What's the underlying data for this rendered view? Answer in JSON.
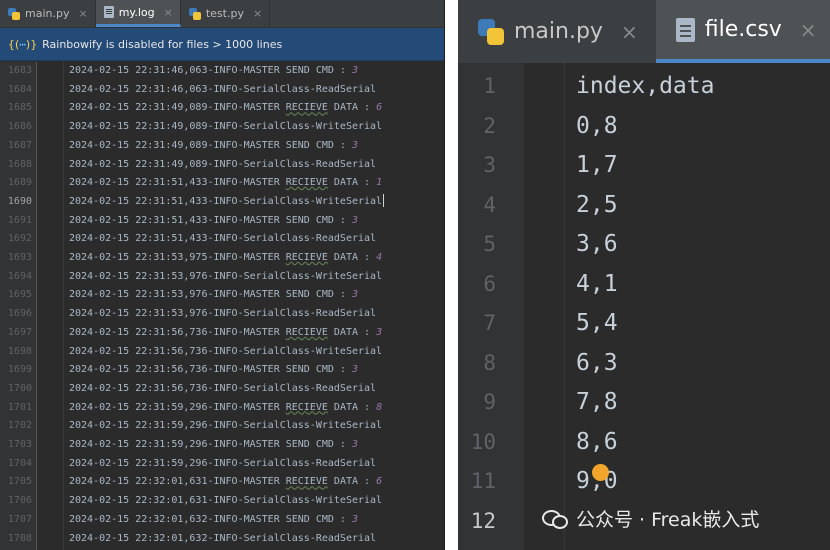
{
  "left_panel": {
    "tabs": [
      {
        "label": "main.py",
        "icon": "python-file-icon",
        "active": false
      },
      {
        "label": "my.log",
        "icon": "log-file-icon",
        "active": true
      },
      {
        "label": "test.py",
        "icon": "python-file-icon",
        "active": false
      }
    ],
    "close_glyph": "×",
    "banner": {
      "icon": "rainbowify-icon",
      "text": "Rainbowify is disabled for files > 1000 lines"
    },
    "current_line": "1690",
    "lines": [
      {
        "n": "1683",
        "pre": "2024-02-15 22:31:46,063-INFO-MASTER SEND CMD : ",
        "kw": "",
        "post": "",
        "num": "3"
      },
      {
        "n": "1684",
        "pre": "2024-02-15 22:31:46,063-INFO-SerialClass-ReadSerial",
        "kw": "",
        "post": "",
        "num": ""
      },
      {
        "n": "1685",
        "pre": "2024-02-15 22:31:49,089-INFO-MASTER ",
        "kw": "RECIEVE",
        "post": " DATA : ",
        "num": "6"
      },
      {
        "n": "1686",
        "pre": "2024-02-15 22:31:49,089-INFO-SerialClass-WriteSerial",
        "kw": "",
        "post": "",
        "num": ""
      },
      {
        "n": "1687",
        "pre": "2024-02-15 22:31:49,089-INFO-MASTER SEND CMD : ",
        "kw": "",
        "post": "",
        "num": "3"
      },
      {
        "n": "1688",
        "pre": "2024-02-15 22:31:49,089-INFO-SerialClass-ReadSerial",
        "kw": "",
        "post": "",
        "num": ""
      },
      {
        "n": "1689",
        "pre": "2024-02-15 22:31:51,433-INFO-MASTER ",
        "kw": "RECIEVE",
        "post": " DATA : ",
        "num": "1"
      },
      {
        "n": "1690",
        "pre": "2024-02-15 22:31:51,433-INFO-SerialClass-WriteSerial",
        "kw": "",
        "post": "",
        "num": ""
      },
      {
        "n": "1691",
        "pre": "2024-02-15 22:31:51,433-INFO-MASTER SEND CMD : ",
        "kw": "",
        "post": "",
        "num": "3"
      },
      {
        "n": "1692",
        "pre": "2024-02-15 22:31:51,433-INFO-SerialClass-ReadSerial",
        "kw": "",
        "post": "",
        "num": ""
      },
      {
        "n": "1693",
        "pre": "2024-02-15 22:31:53,975-INFO-MASTER ",
        "kw": "RECIEVE",
        "post": " DATA : ",
        "num": "4"
      },
      {
        "n": "1694",
        "pre": "2024-02-15 22:31:53,976-INFO-SerialClass-WriteSerial",
        "kw": "",
        "post": "",
        "num": ""
      },
      {
        "n": "1695",
        "pre": "2024-02-15 22:31:53,976-INFO-MASTER SEND CMD : ",
        "kw": "",
        "post": "",
        "num": "3"
      },
      {
        "n": "1696",
        "pre": "2024-02-15 22:31:53,976-INFO-SerialClass-ReadSerial",
        "kw": "",
        "post": "",
        "num": ""
      },
      {
        "n": "1697",
        "pre": "2024-02-15 22:31:56,736-INFO-MASTER ",
        "kw": "RECIEVE",
        "post": " DATA : ",
        "num": "3"
      },
      {
        "n": "1698",
        "pre": "2024-02-15 22:31:56,736-INFO-SerialClass-WriteSerial",
        "kw": "",
        "post": "",
        "num": ""
      },
      {
        "n": "1699",
        "pre": "2024-02-15 22:31:56,736-INFO-MASTER SEND CMD : ",
        "kw": "",
        "post": "",
        "num": "3"
      },
      {
        "n": "1700",
        "pre": "2024-02-15 22:31:56,736-INFO-SerialClass-ReadSerial",
        "kw": "",
        "post": "",
        "num": ""
      },
      {
        "n": "1701",
        "pre": "2024-02-15 22:31:59,296-INFO-MASTER ",
        "kw": "RECIEVE",
        "post": " DATA : ",
        "num": "8"
      },
      {
        "n": "1702",
        "pre": "2024-02-15 22:31:59,296-INFO-SerialClass-WriteSerial",
        "kw": "",
        "post": "",
        "num": ""
      },
      {
        "n": "1703",
        "pre": "2024-02-15 22:31:59,296-INFO-MASTER SEND CMD : ",
        "kw": "",
        "post": "",
        "num": "3"
      },
      {
        "n": "1704",
        "pre": "2024-02-15 22:31:59,296-INFO-SerialClass-ReadSerial",
        "kw": "",
        "post": "",
        "num": ""
      },
      {
        "n": "1705",
        "pre": "2024-02-15 22:32:01,631-INFO-MASTER ",
        "kw": "RECIEVE",
        "post": " DATA : ",
        "num": "6"
      },
      {
        "n": "1706",
        "pre": "2024-02-15 22:32:01,631-INFO-SerialClass-WriteSerial",
        "kw": "",
        "post": "",
        "num": ""
      },
      {
        "n": "1707",
        "pre": "2024-02-15 22:32:01,632-INFO-MASTER SEND CMD : ",
        "kw": "",
        "post": "",
        "num": "3"
      },
      {
        "n": "1708",
        "pre": "2024-02-15 22:32:01,632-INFO-SerialClass-ReadSerial",
        "kw": "",
        "post": "",
        "num": ""
      }
    ]
  },
  "right_panel": {
    "tabs": [
      {
        "label": "main.py",
        "icon": "python-file-icon",
        "active": false
      },
      {
        "label": "file.csv",
        "icon": "csv-file-icon",
        "active": true
      }
    ],
    "close_glyph": "×",
    "current_line": "12",
    "lines": [
      {
        "n": "1",
        "text": "index,data"
      },
      {
        "n": "2",
        "text": "0,8"
      },
      {
        "n": "3",
        "text": "1,7"
      },
      {
        "n": "4",
        "text": "2,5"
      },
      {
        "n": "5",
        "text": "3,6"
      },
      {
        "n": "6",
        "text": "4,1"
      },
      {
        "n": "7",
        "text": "5,4"
      },
      {
        "n": "8",
        "text": "6,3"
      },
      {
        "n": "9",
        "text": "7,8"
      },
      {
        "n": "10",
        "text": "8,6"
      },
      {
        "n": "11",
        "text": "9,0"
      },
      {
        "n": "12",
        "text": ""
      }
    ],
    "intention_bulb_icon": "lightbulb-icon",
    "watermark": {
      "icon": "wechat-logo-icon",
      "text": "公众号 · Freak嵌入式"
    }
  },
  "colors": {
    "editor_bg": "#2b2b2b",
    "tabbar_bg": "#3c3f41",
    "active_tab_underline": "#4a88c7",
    "banner_bg": "#244a78",
    "log_text": "#a9b7c6",
    "log_number": "#9876aa",
    "line_number": "#606366"
  }
}
